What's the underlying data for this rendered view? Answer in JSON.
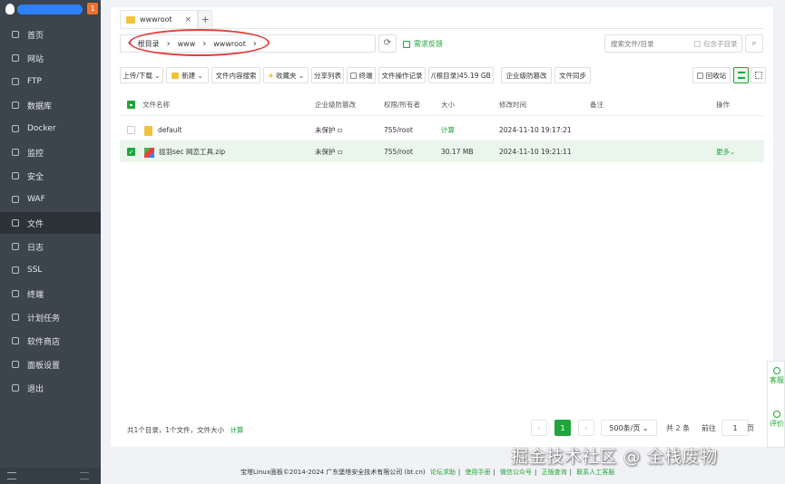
{
  "sidebar": {
    "badge": "1",
    "items": [
      {
        "label": "首页",
        "icon": "home-icon"
      },
      {
        "label": "网站",
        "icon": "globe-icon"
      },
      {
        "label": "FTP",
        "icon": "ftp-icon"
      },
      {
        "label": "数据库",
        "icon": "database-icon"
      },
      {
        "label": "Docker",
        "icon": "docker-icon"
      },
      {
        "label": "监控",
        "icon": "monitor-icon"
      },
      {
        "label": "安全",
        "icon": "shield-icon"
      },
      {
        "label": "WAF",
        "icon": "waf-icon"
      },
      {
        "label": "文件",
        "icon": "folder-icon"
      },
      {
        "label": "日志",
        "icon": "log-icon"
      },
      {
        "label": "SSL",
        "icon": "ssl-icon"
      },
      {
        "label": "终端",
        "icon": "terminal-icon"
      },
      {
        "label": "计划任务",
        "icon": "clock-icon"
      },
      {
        "label": "软件商店",
        "icon": "store-icon"
      },
      {
        "label": "面板设置",
        "icon": "settings-icon"
      },
      {
        "label": "退出",
        "icon": "logout-icon"
      }
    ],
    "active_index": 8
  },
  "tabs": [
    {
      "label": "wwwroot",
      "close": "×"
    }
  ],
  "tab_add": "+",
  "path": {
    "back": "‹",
    "crumbs": [
      "根目录",
      "www",
      "wwwroot"
    ],
    "sep": "›",
    "refresh": "⟳",
    "feedback": "需求反馈"
  },
  "search": {
    "placeholder": "搜索文件/目录",
    "subdir_label": "包含子目录",
    "button": "⌕"
  },
  "toolbar": {
    "upload": "上传/下载 ⌄",
    "new": "新建 ⌄",
    "content_search": "文件内容搜索",
    "favorites": "收藏夹 ⌄",
    "share_list": "分享列表",
    "terminal": "终端",
    "op_log": "文件操作记录",
    "disk": "/(根目录)45.19 GB",
    "enterprise": "企业级防篡改",
    "sync": "文件同步",
    "recycle": "回收站"
  },
  "table": {
    "headers": {
      "name": "文件名称",
      "protect": "企业级防篡改",
      "perm": "权限/所有者",
      "size": "大小",
      "mtime": "修改时间",
      "note": "备注",
      "ops": "操作"
    },
    "rows": [
      {
        "name": "default",
        "type": "folder",
        "protect": "未保护",
        "perm": "755/root",
        "size": "计算",
        "size_link": true,
        "mtime": "2024-11-10 19:17:21",
        "ops": "",
        "selected": false
      },
      {
        "name": "拢羽sec 网恋工具.zip",
        "type": "zip",
        "protect": "未保护",
        "perm": "755/root",
        "size": "30.17 MB",
        "size_link": false,
        "mtime": "2024-11-10 19:21:11",
        "ops": "更多⌄",
        "selected": true
      }
    ]
  },
  "footer": {
    "summary": "共1个目录，1个文件，文件大小",
    "calc": "计算",
    "prev": "‹",
    "page": "1",
    "next": "›",
    "per_page": "500条/页 ⌄",
    "total": "共 2 条",
    "goto": "前往",
    "goto_value": "1",
    "page_unit": "页"
  },
  "copyright": {
    "text": "宝塔Linux面板©2014-2024 广东堡塔安全技术有限公司 (bt.cn)",
    "links": [
      "论坛求助",
      "使用手册",
      "微信公众号",
      "正版查询",
      "联系人工客服"
    ]
  },
  "watermark": "掘金技术社区 @ 全栈废物",
  "float": {
    "service": "客服",
    "review": "评价"
  },
  "colors": {
    "accent": "#20a53a",
    "sidebar": "#3c444d",
    "annotation": "#e0403b"
  }
}
